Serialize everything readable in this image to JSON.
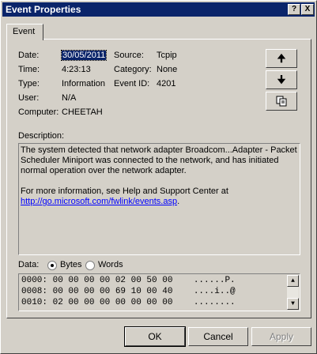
{
  "window": {
    "title": "Event Properties",
    "help_label": "?",
    "close_label": "X"
  },
  "tab": {
    "label": "Event"
  },
  "fields": {
    "date_label": "Date:",
    "date_value": "30/05/2011",
    "source_label": "Source:",
    "source_value": "Tcpip",
    "time_label": "Time:",
    "time_value": "4:23:13",
    "category_label": "Category:",
    "category_value": "None",
    "type_label": "Type:",
    "type_value": "Information",
    "eventid_label": "Event ID:",
    "eventid_value": "4201",
    "user_label": "User:",
    "user_value": "N/A",
    "computer_label": "Computer:",
    "computer_value": "CHEETAH"
  },
  "side_buttons": {
    "up_icon": "arrow-up-icon",
    "down_icon": "arrow-down-icon",
    "copy_icon": "copy-icon"
  },
  "description": {
    "label": "Description:",
    "para1": "The system detected that network adapter Broadcom...Adapter - Packet Scheduler Miniport was connected to the network, and has initiated normal operation over the network adapter.",
    "para2": "For more information, see Help and Support Center at",
    "link": "http://go.microsoft.com/fwlink/events.asp",
    "link_suffix": "."
  },
  "data": {
    "label": "Data:",
    "bytes_label": "Bytes",
    "words_label": "Words",
    "selected": "Bytes",
    "rows": [
      "0000: 00 00 00 00 02 00 50 00    ......P.",
      "0008: 00 00 00 00 69 10 00 40    ....i..@",
      "0010: 02 00 00 00 00 00 00 00    ........"
    ]
  },
  "buttons": {
    "ok": "OK",
    "cancel": "Cancel",
    "apply": "Apply"
  }
}
